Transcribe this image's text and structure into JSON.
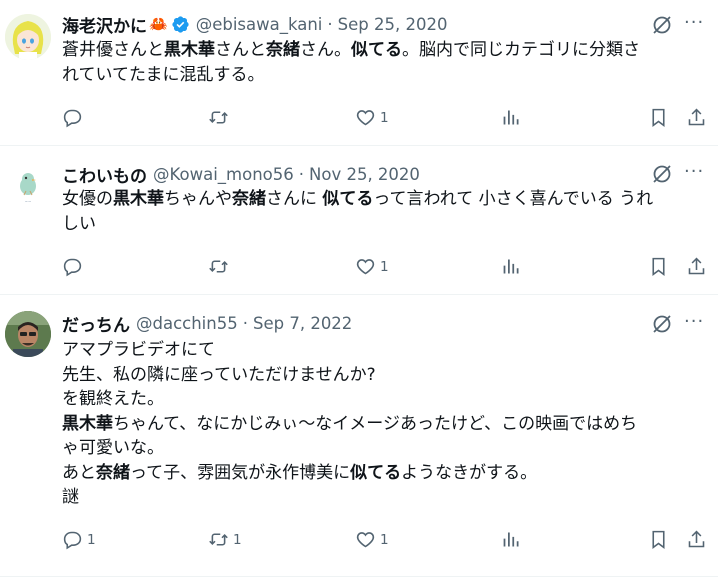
{
  "tweets": [
    {
      "name": "海老沢かに",
      "name_emoji": "🦀",
      "handle": "@ebisawa_kani",
      "date": "Sep 25, 2020",
      "text_html": "蒼井優さんと<b>黒木華</b>さんと<b>奈緒</b>さん。<b>似てる</b>。脳内で同じカテゴリに分類さ<br>れていてたまに混乱する。",
      "reply_count": "",
      "retweet_count": "",
      "like_count": "1"
    },
    {
      "name": "こわいもの",
      "handle": "@Kowai_mono56",
      "date": "Nov 25, 2020",
      "text_html": "女優の<b>黒木華</b>ちゃんや<b>奈緒</b>さんに <b>似てる</b>って言われて 小さく喜んでいる うれ<br>しい",
      "reply_count": "",
      "retweet_count": "",
      "like_count": "1"
    },
    {
      "name": "だっちん",
      "handle": "@dacchin55",
      "date": "Sep 7, 2022",
      "text_html": "アマプラビデオにて<br>先生、私の隣に座っていただけませんか?<br>を観終えた。<br><b>黒木華</b>ちゃんて、なにかじみぃ〜なイメージあったけど、この映画ではめち<br>ゃ可愛いな。<br>あと<b>奈緒</b>って子、雰囲気が永作博美に<b>似てる</b>ようなきがする。<br>謎",
      "reply_count": "1",
      "retweet_count": "1",
      "like_count": "1"
    }
  ],
  "more_label": "···",
  "colors": {
    "text": "#0f1419",
    "muted": "#536471",
    "verified": "#1d9bf0",
    "divider": "#eff3f4"
  }
}
